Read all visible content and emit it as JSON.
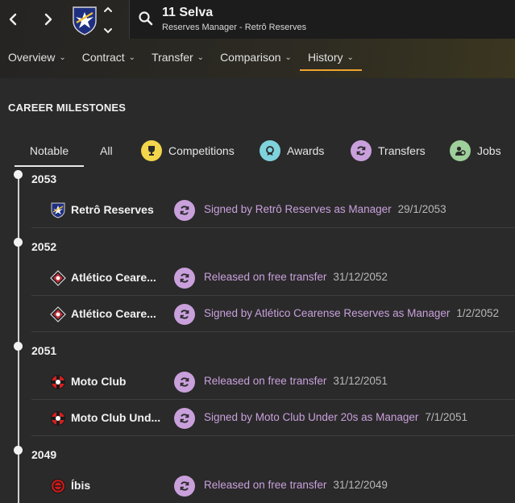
{
  "header": {
    "name": "11 Selva",
    "role": "Reserves Manager - Retrô Reserves"
  },
  "tabs": [
    {
      "label": "Overview"
    },
    {
      "label": "Contract"
    },
    {
      "label": "Transfer"
    },
    {
      "label": "Comparison"
    },
    {
      "label": "History",
      "active": true
    }
  ],
  "section_title": "CAREER MILESTONES",
  "filters": [
    {
      "label": "Notable",
      "active": true
    },
    {
      "label": "All"
    },
    {
      "label": "Competitions",
      "icon": "trophy-icon",
      "color": "#f2d64b"
    },
    {
      "label": "Awards",
      "icon": "medal-icon",
      "color": "#7fd3dc"
    },
    {
      "label": "Transfers",
      "icon": "transfer-icon",
      "color": "#c9a0dc"
    },
    {
      "label": "Jobs",
      "icon": "jobs-icon",
      "color": "#9fcf9a"
    }
  ],
  "milestones": [
    {
      "year": "2053",
      "items": [
        {
          "club": "Retrô Reserves",
          "crest": "retro-crest-icon",
          "description": "Signed by Retrô Reserves as Manager",
          "date": "29/1/2053"
        }
      ]
    },
    {
      "year": "2052",
      "items": [
        {
          "club": "Atlético Ceare...",
          "crest": "atletico-crest-icon",
          "description": "Released on free transfer",
          "date": "31/12/2052"
        },
        {
          "club": "Atlético Ceare...",
          "crest": "atletico-crest-icon",
          "description": "Signed by Atlético Cearense Reserves as Manager",
          "date": "1/2/2052"
        }
      ]
    },
    {
      "year": "2051",
      "items": [
        {
          "club": "Moto Club",
          "crest": "moto-club-crest-icon",
          "description": "Released on free transfer",
          "date": "31/12/2051"
        },
        {
          "club": "Moto Club Und...",
          "crest": "moto-club-crest-icon",
          "description": "Signed by Moto Club Under 20s as Manager",
          "date": "7/1/2051"
        }
      ]
    },
    {
      "year": "2049",
      "items": [
        {
          "club": "Íbis",
          "crest": "ibis-crest-icon",
          "description": "Released on free transfer",
          "date": "31/12/2049"
        }
      ]
    }
  ],
  "colors": {
    "accent": "#f0a430",
    "transfer": "#c9a0dc",
    "background": "#2a2a2a"
  }
}
